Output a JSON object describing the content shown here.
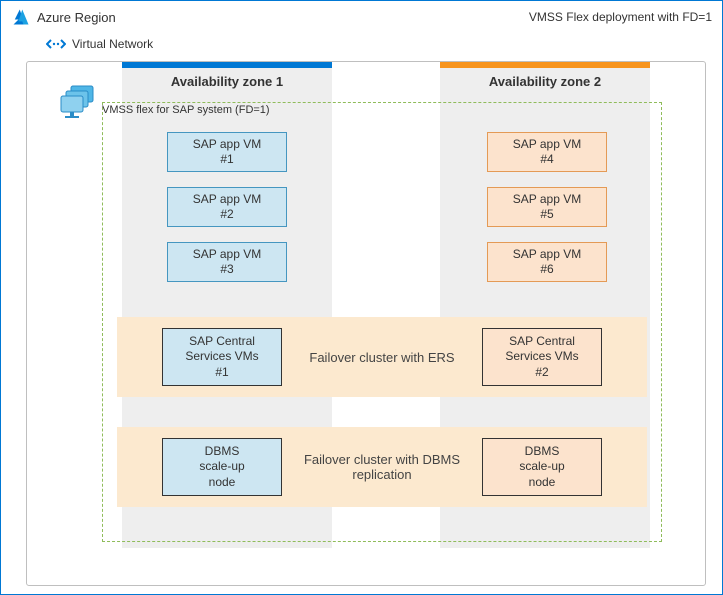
{
  "header": {
    "region": "Azure Region",
    "deployment": "VMSS Flex deployment with FD=1"
  },
  "vnet": {
    "label": "Virtual Network"
  },
  "zones": {
    "z1": {
      "title": "Availability zone 1"
    },
    "z2": {
      "title": "Availability zone 2"
    }
  },
  "vmss": {
    "caption": "VMSS flex for SAP system (FD=1)"
  },
  "app_vms": {
    "z1": [
      {
        "line1": "SAP app VM",
        "line2": "#1"
      },
      {
        "line1": "SAP app VM",
        "line2": "#2"
      },
      {
        "line1": "SAP app VM",
        "line2": "#3"
      }
    ],
    "z2": [
      {
        "line1": "SAP app VM",
        "line2": "#4"
      },
      {
        "line1": "SAP app VM",
        "line2": "#5"
      },
      {
        "line1": "SAP app VM",
        "line2": "#6"
      }
    ]
  },
  "clusters": {
    "scs": {
      "label": "Failover cluster with ERS",
      "left": {
        "l1": "SAP Central",
        "l2": "Services VMs",
        "l3": "#1"
      },
      "right": {
        "l1": "SAP Central",
        "l2": "Services VMs",
        "l3": "#2"
      }
    },
    "dbms": {
      "label": "Failover cluster with DBMS replication",
      "left": {
        "l1": "DBMS",
        "l2": "scale-up",
        "l3": "node"
      },
      "right": {
        "l1": "DBMS",
        "l2": "scale-up",
        "l3": "node"
      }
    }
  }
}
